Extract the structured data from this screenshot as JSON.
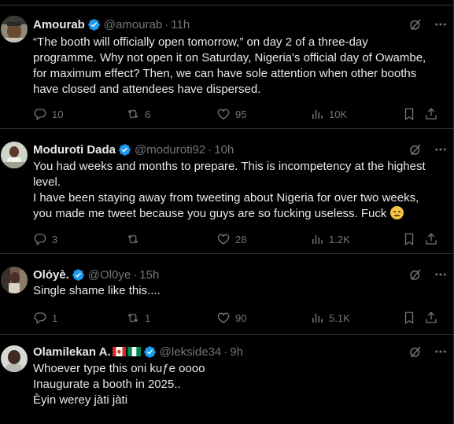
{
  "colors": {
    "background": "#000000",
    "text": "#e7e9ea",
    "muted": "#71767b",
    "verified": "#1d9bf0",
    "divider": "#2f3336"
  },
  "tweets": [
    {
      "name": "Amourab",
      "handle": "@amourab",
      "dot": "·",
      "time": "11h",
      "lines": [
        "“The booth will officially open tomorrow,” on day 2 of a three-day",
        "programme. Why not open it on Saturday, Nigeria's official day of Owambe,",
        "for maximum effect? Then, we can have sole attention when other booths",
        "have closed and attendees have dispersed."
      ],
      "replies": "10",
      "reposts": "6",
      "likes": "95",
      "views": "10K"
    },
    {
      "name": "Moduroti Dada",
      "handle": "@moduroti92",
      "dot": "·",
      "time": "10h",
      "lines": [
        "You had weeks and months to prepare. This is incompetency at the highest",
        "level.",
        "I have been staying away from tweeting about Nigeria for over two weeks,",
        "you made me tweet because you guys are so fucking useless. Fuck"
      ],
      "emoji": "pensive-face-emoji",
      "replies": "3",
      "reposts": "",
      "likes": "28",
      "views": "1.2K"
    },
    {
      "name": "Olóyè.",
      "handle": "@Ol0ye",
      "dot": "·",
      "time": "15h",
      "lines": [
        "Single shame like this...."
      ],
      "replies": "1",
      "reposts": "1",
      "likes": "90",
      "views": "5.1K"
    },
    {
      "name": "Olamilekan A.",
      "handle": "@lekside34",
      "dot": "·",
      "time": "9h",
      "flags": [
        "canada-flag-emoji",
        "nigeria-flag-emoji"
      ],
      "lines": [
        "Whoever type this oni kuƒe oooo",
        "Inaugurate a booth in 2025..",
        "Èyin werey jàti jàti"
      ]
    }
  ]
}
